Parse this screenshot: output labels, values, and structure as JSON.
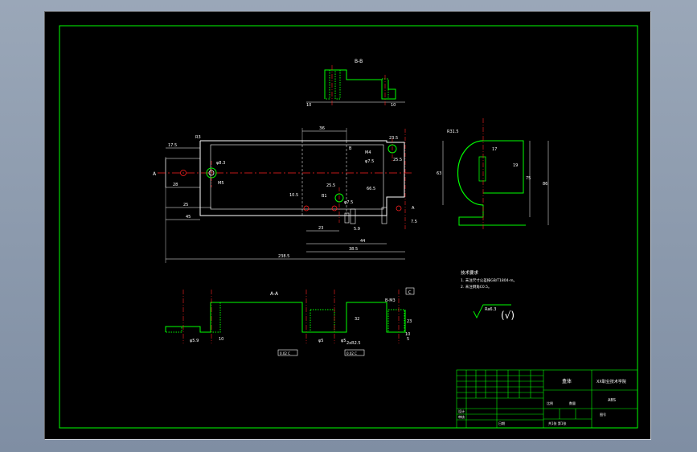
{
  "colors": {
    "background": "#000000",
    "frame": "#00ff00",
    "outline": "#ffffff",
    "centerline": "#ff2020",
    "hatch": "#00ff00",
    "dimension": "#ffffff"
  },
  "views": {
    "section_bb": "B-B",
    "section_aa": "A-A"
  },
  "dims": {
    "d36": "36",
    "d17_5": "17.5",
    "d23_5": "23.5",
    "r1": "R3",
    "d25_5": "25.5",
    "d28": "28",
    "m4": "M4",
    "d7_5": "φ7.5",
    "d66_5": "66.5",
    "d25": "25",
    "d45": "45",
    "d10_5": "10.5",
    "d25_5b": "25.5",
    "b1": "B1",
    "d7_5b": "φ7.5",
    "d8_3": "φ8.3",
    "m5": "M5",
    "a": "A",
    "b": "B",
    "d7_5c": "7.5",
    "d23": "23",
    "d5_9": "5.9",
    "d44": "44",
    "d38_5": "38.5",
    "d238_5": "238.5",
    "r31_5": "R31.5",
    "d63": "63",
    "d17": "17",
    "d19": "19",
    "d75": "75",
    "d86": "86",
    "d10a": "10",
    "d10b": "10",
    "bm3": "B-M3",
    "d32": "32",
    "d23b": "23",
    "d10c": "10",
    "dd5_9": "φ5.9",
    "d10d": "10",
    "dd5": "φ5",
    "dd5b": "φ5",
    "rr25": "2xR2.5",
    "d5": "5",
    "datum": "C",
    "tol1": "0.02 C",
    "tol2": "0.02 C"
  },
  "notes": {
    "title": "技术要求",
    "line1": "1. 未注尺寸公差按GB/T1804-m。",
    "line2": "2. 未注倒角C0.5。"
  },
  "surface": {
    "roughness": "Ra6.3",
    "paren": "(√)"
  },
  "title_block": {
    "part_name": "盒体",
    "school": "XX职业技术学院",
    "material": "ABS",
    "scale": "比例",
    "quantity": "数量",
    "sheet": "共1张 第1张",
    "drawing_no": "图号",
    "designer": "设计",
    "checker": "审核",
    "date": "日期"
  }
}
